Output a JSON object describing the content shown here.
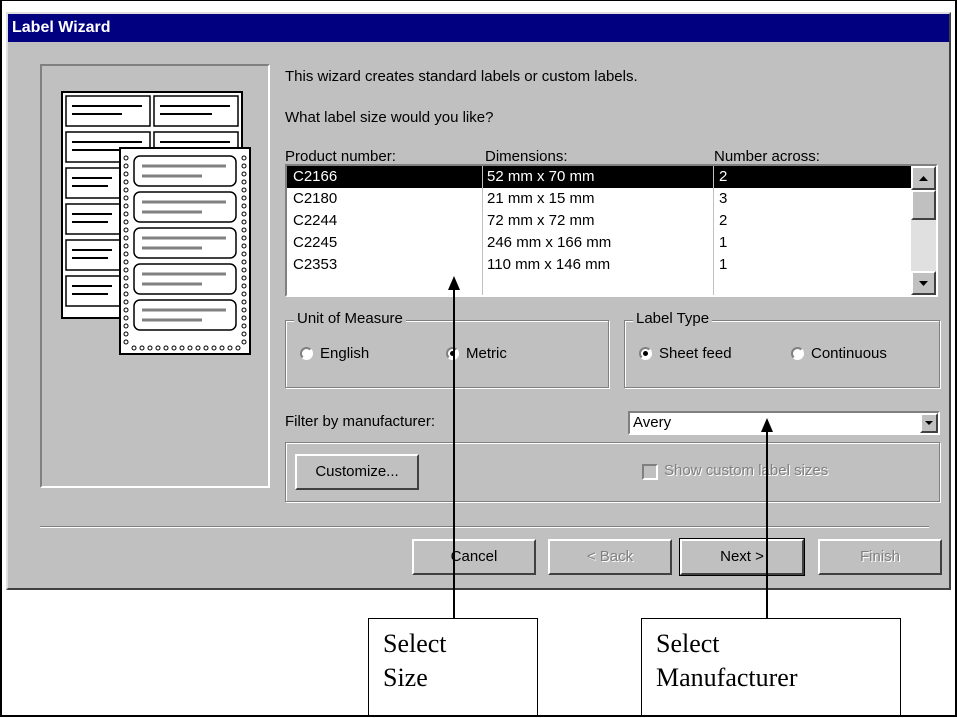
{
  "window": {
    "title": "Label Wizard"
  },
  "intro": {
    "line1": "This wizard creates standard labels or custom labels.",
    "question": "What label size would you like?"
  },
  "list": {
    "headers": [
      "Product number:",
      "Dimensions:",
      "Number across:"
    ],
    "rows": [
      [
        "C2166",
        "52 mm x 70 mm",
        "2"
      ],
      [
        "C2180",
        "21 mm x 15 mm",
        "3"
      ],
      [
        "C2244",
        "72 mm x 72 mm",
        "2"
      ],
      [
        "C2245",
        "246 mm x 166 mm",
        "1"
      ],
      [
        "C2353",
        "110 mm x 146 mm",
        "1"
      ]
    ],
    "selected_index": 0
  },
  "unit_of_measure": {
    "legend": "Unit of Measure",
    "options": [
      "English",
      "Metric"
    ],
    "selected": "Metric"
  },
  "label_type": {
    "legend": "Label Type",
    "options": [
      "Sheet feed",
      "Continuous"
    ],
    "selected": "Sheet feed"
  },
  "filter": {
    "label": "Filter by  manufacturer:",
    "value": "Avery"
  },
  "customize_button": "Customize...",
  "show_custom_sizes": {
    "label": "Show custom label sizes",
    "checked": false,
    "enabled": false
  },
  "buttons": {
    "cancel": "Cancel",
    "back": "< Back",
    "next": "Next >",
    "finish": "Finish"
  },
  "callouts": {
    "size": [
      "Select",
      "Size"
    ],
    "manufacturer": [
      "Select",
      "Manufacturer"
    ]
  }
}
